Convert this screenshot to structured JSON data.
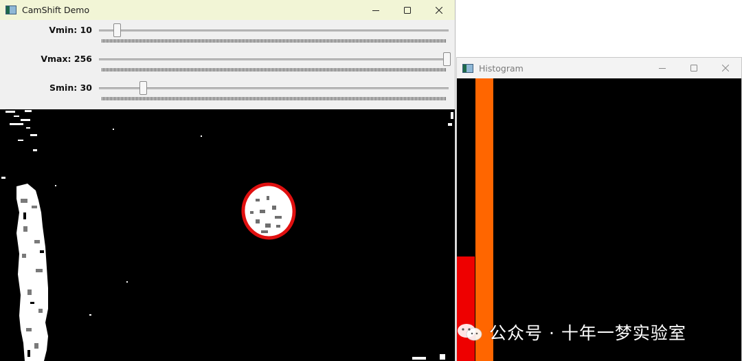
{
  "camshift_window": {
    "title": "CamShift Demo",
    "trackbars": [
      {
        "label": "Vmin: 10",
        "value": 10,
        "max": 256
      },
      {
        "label": "Vmax: 256",
        "value": 256,
        "max": 256
      },
      {
        "label": "Smin: 30",
        "value": 30,
        "max": 256
      }
    ],
    "tracking_ellipse_color": "#e01010"
  },
  "histogram_window": {
    "title": "Histogram",
    "bar_colors": [
      "#ee0000",
      "#ff6600"
    ]
  },
  "watermark": {
    "text": "公众号 · 十年一梦实验室"
  }
}
